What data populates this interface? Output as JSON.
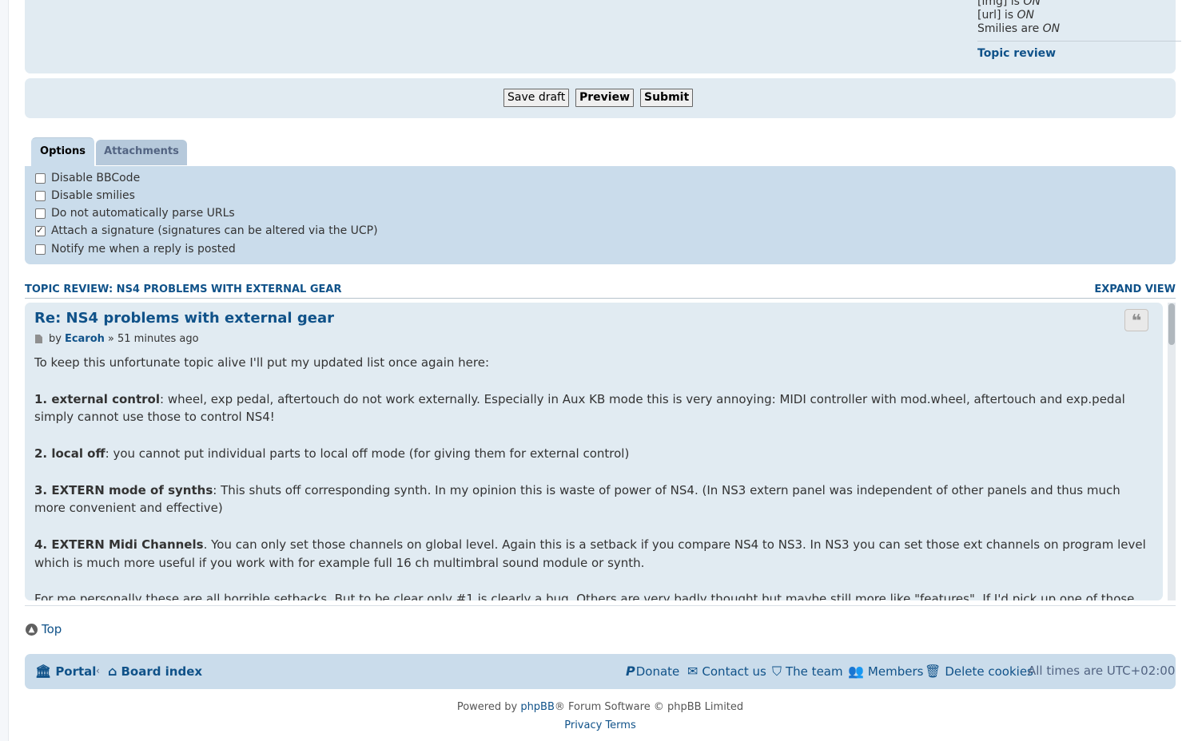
{
  "bbcode_status": {
    "img_prefix": "[img] is ",
    "img_state": "ON",
    "url_prefix": "[url] is ",
    "url_state": "ON",
    "smilies_prefix": "Smilies are ",
    "smilies_state": "ON",
    "topic_review_link": "Topic review"
  },
  "submit_buttons": {
    "save_draft": "Save draft",
    "preview": "Preview",
    "submit": "Submit"
  },
  "tabs": [
    {
      "label": "Options",
      "active": true
    },
    {
      "label": "Attachments",
      "active": false
    }
  ],
  "options": [
    {
      "label": "Disable BBCode",
      "checked": false
    },
    {
      "label": "Disable smilies",
      "checked": false
    },
    {
      "label": "Do not automatically parse URLs",
      "checked": false
    },
    {
      "label": "Attach a signature (signatures can be altered via the UCP)",
      "checked": true
    },
    {
      "label": "Notify me when a reply is posted",
      "checked": false
    }
  ],
  "topic_review": {
    "heading": "TOPIC REVIEW: NS4 PROBLEMS WITH EXTERNAL GEAR",
    "expand": "EXPAND VIEW"
  },
  "post": {
    "title": "Re: NS4 problems with external gear",
    "by": "by",
    "author": "Ecaroh",
    "time": "» 51 minutes ago",
    "intro": "To keep this unfortunate topic alive I'll put my updated list once again here:",
    "items": [
      {
        "head": "1. external control",
        "text": ": wheel, exp pedal, aftertouch do not work externally. Especially in Aux KB mode this is very annoying: MIDI controller with mod.wheel, aftertouch and exp.pedal simply cannot use those to control NS4!"
      },
      {
        "head": "2. local off",
        "text": ": you cannot put individual parts to local off mode (for giving them for external control)"
      },
      {
        "head": "3. EXTERN mode of synths",
        "text": ": This shuts off corresponding synth. In my opinion this is waste of power of NS4. (In NS3 extern panel was independent of other panels and thus much more convenient and effective)"
      },
      {
        "head": "4. EXTERN Midi Channels",
        "text": ". You can only set those channels on global level. Again this is a setback if you compare NS4 to NS3. In NS3 you can set those ext channels on program level which is much more useful if you work with for example full 16 ch multimbral sound module or synth."
      }
    ],
    "outro": "For me personally these are all horrible setbacks. But to be clear only #1 is clearly a bug. Others are very badly thought but maybe still more like \"features\". If I'd pick up one of those, maybe"
  },
  "top_link": "Top",
  "footer": {
    "portal": "Portal",
    "board_index": "Board index",
    "donate": "Donate",
    "contact": "Contact us",
    "team": "The team",
    "members": "Members",
    "delete_cookies": "Delete cookies",
    "timezone": "All times are UTC+02:00"
  },
  "powered": {
    "prefix": "Powered by ",
    "phpbb": "phpBB",
    "suffix": "® Forum Software © phpBB Limited"
  },
  "bottom_links": {
    "privacy": "Privacy",
    "terms": "Terms"
  },
  "icons": {
    "quote": "quote-icon",
    "post": "file-icon",
    "top": "circle-arrow-up-icon",
    "portal": "bank-icon",
    "home": "home-icon",
    "donate": "paypal-icon",
    "contact": "envelope-icon",
    "team": "shield-icon",
    "members": "users-icon",
    "trash": "trash-icon"
  }
}
